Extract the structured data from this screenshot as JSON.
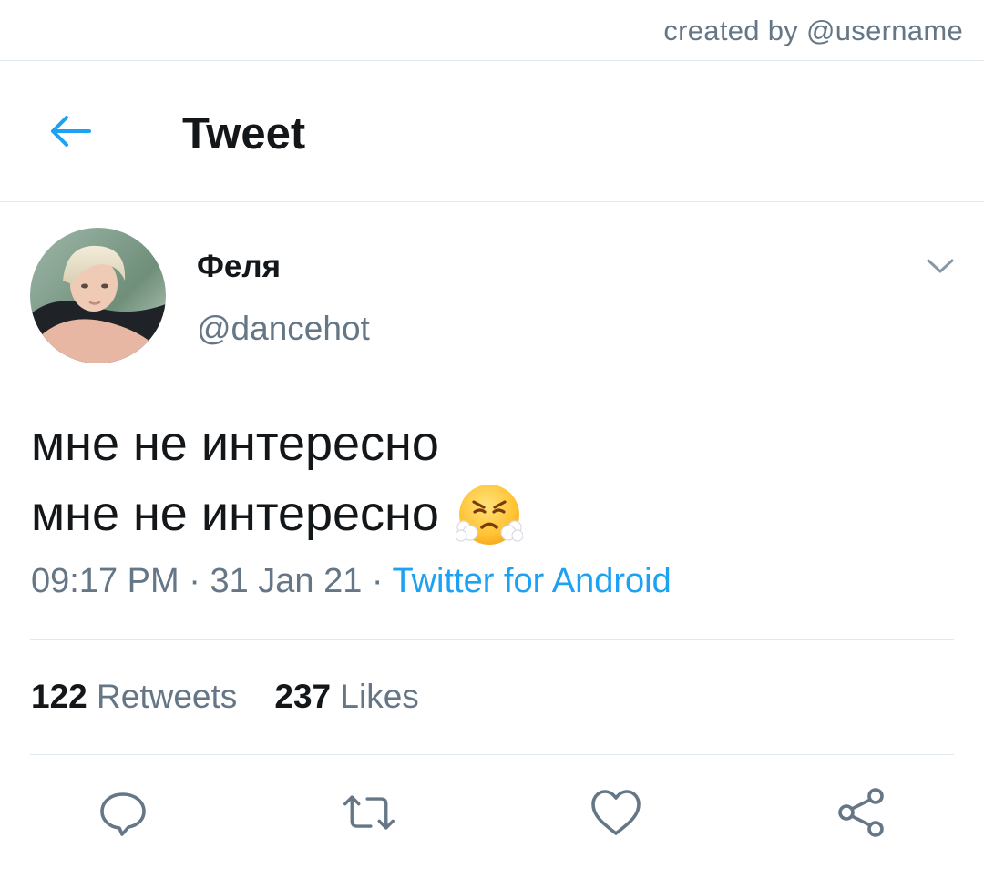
{
  "credit": "created by @username",
  "header": {
    "title": "Tweet",
    "back_icon": "arrow-left-icon"
  },
  "tweet": {
    "author": {
      "display_name": "Феля",
      "handle": "@dancehot"
    },
    "lines": [
      "мне не интересно",
      "мне не интересно"
    ],
    "emoji": "face-with-steam-from-nose",
    "time": "09:17 PM",
    "separator": " · ",
    "date": "31 Jan 21",
    "source": "Twitter for Android"
  },
  "stats": {
    "retweets_count": "122",
    "retweets_label": "Retweets",
    "likes_count": "237",
    "likes_label": "Likes"
  },
  "actions": [
    "reply-icon",
    "retweet-icon",
    "like-icon",
    "share-icon"
  ],
  "colors": {
    "accent": "#1da1f2",
    "text_primary": "#14171a",
    "text_secondary": "#657786",
    "divider": "#e1e8ed"
  }
}
